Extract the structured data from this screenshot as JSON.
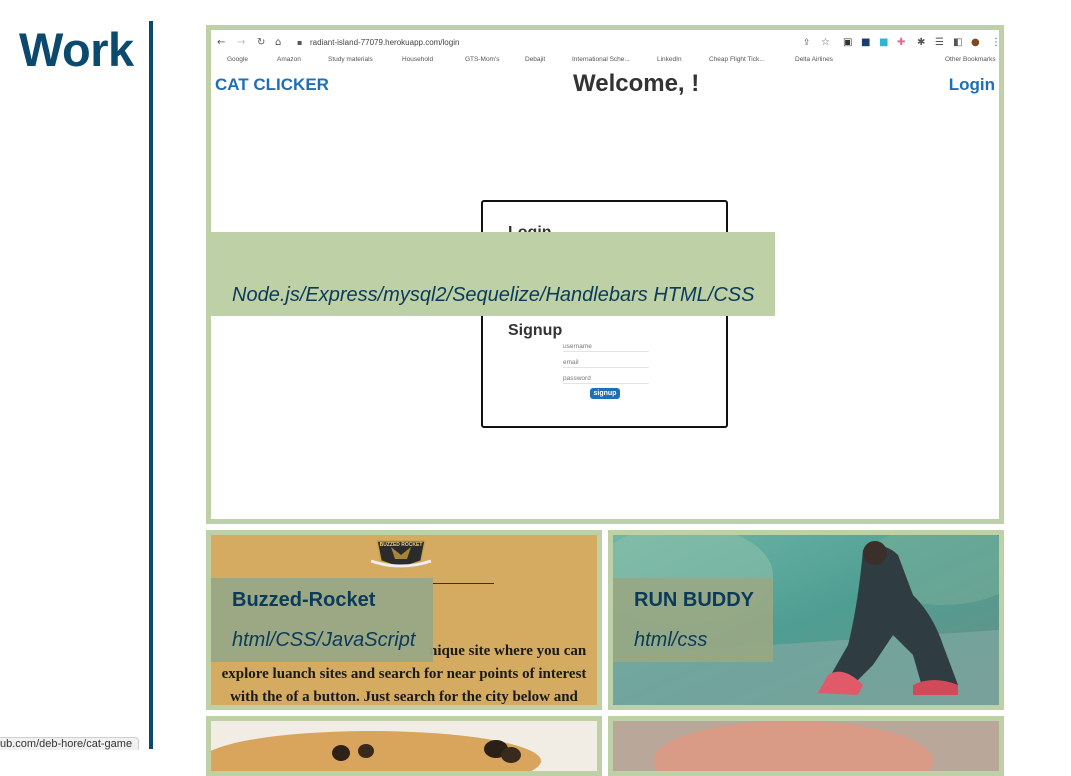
{
  "section": {
    "title": "Work"
  },
  "featured": {
    "browser": {
      "url": "radiant-island-77079.herokuapp.com/login",
      "bookmarks": [
        "Google",
        "Amazon",
        "Study materials",
        "Household",
        "GTS-Mom's",
        "Debajit",
        "International Sche...",
        "LinkedIn",
        "Cheap Flight Tick...",
        "Delta Airlines",
        "Other Bookmarks"
      ]
    },
    "app": {
      "brand": "CAT CLICKER",
      "welcome": "Welcome, !",
      "login_link": "Login",
      "login_heading": "Login",
      "signup_heading": "Signup",
      "username_placeholder": "username",
      "email_placeholder": "email",
      "password_placeholder": "password",
      "signup_button": "signup"
    },
    "overlay": {
      "title": "",
      "tech": "Node.js/Express/mysql2/Sequelize/Handlebars HTML/CSS"
    }
  },
  "projects": [
    {
      "title": "Buzzed-Rocket",
      "tech": "html/CSS/JavaScript",
      "description_lines": [
        "nique site where you can",
        "explore luanch sites and search for near points of interest",
        "with the of a button. Just search for the city below and"
      ],
      "logo_text": "BUZZED ROCKET"
    },
    {
      "title": "RUN BUDDY",
      "tech": "html/css"
    }
  ],
  "status_bar": {
    "url": "ub.com/deb-hore/cat-game"
  },
  "colors": {
    "accent": "#0b4a6e",
    "card_border": "#bdd0a6",
    "overlay": "#bdd0a6"
  }
}
